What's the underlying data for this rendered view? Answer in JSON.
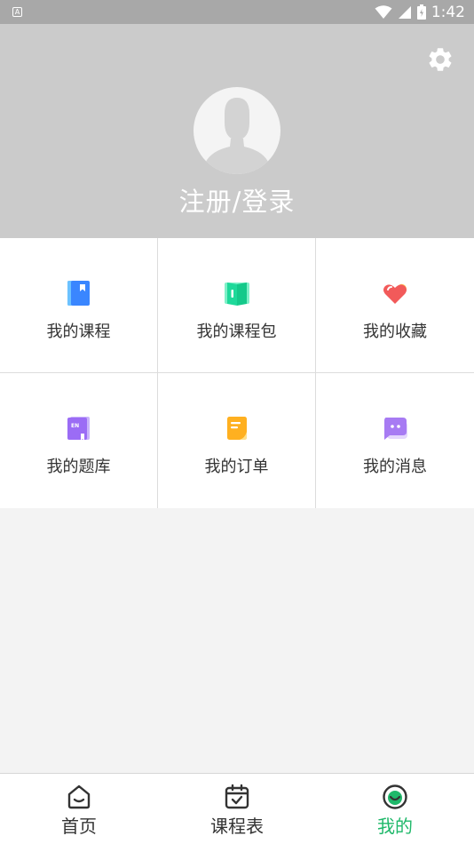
{
  "status_bar": {
    "time": "1:42",
    "notification_letter": "A"
  },
  "header": {
    "login_label": "注册/登录"
  },
  "menu": [
    {
      "label": "我的课程",
      "icon": "book-bookmark-icon",
      "color": "#3a86ff"
    },
    {
      "label": "我的课程包",
      "icon": "course-package-icon",
      "color": "#1ed99a"
    },
    {
      "label": "我的收藏",
      "icon": "heart-icon",
      "color": "#f25a5a"
    },
    {
      "label": "我的题库",
      "icon": "question-bank-icon",
      "color": "#9b6cf5"
    },
    {
      "label": "我的订单",
      "icon": "order-note-icon",
      "color": "#ffb020"
    },
    {
      "label": "我的消息",
      "icon": "message-bubble-icon",
      "color": "#a77bf3"
    }
  ],
  "bottom_nav": {
    "items": [
      {
        "label": "首页",
        "icon": "home-icon",
        "active": false
      },
      {
        "label": "课程表",
        "icon": "calendar-check-icon",
        "active": false
      },
      {
        "label": "我的",
        "icon": "profile-smile-icon",
        "active": true
      }
    ],
    "active_color": "#1fb86a"
  }
}
